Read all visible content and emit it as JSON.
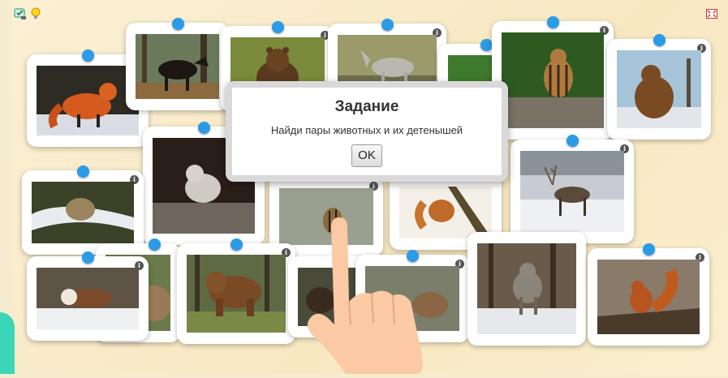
{
  "dialog": {
    "title": "Задание",
    "message": "Найди пары животных и их детенышей",
    "ok_label": "OK"
  },
  "toolbar": {
    "left_icons": [
      "help-check-icon",
      "hint-lightbulb-icon"
    ],
    "right_icons": [
      "fullscreen-icon"
    ]
  },
  "cards": [
    {
      "animal": "fox",
      "info_icon": false
    },
    {
      "animal": "moose",
      "info_icon": false
    },
    {
      "animal": "bear-cub",
      "info_icon": true
    },
    {
      "animal": "moose-calf",
      "info_icon": true
    },
    {
      "animal": "fox-cub",
      "info_icon": true
    },
    {
      "animal": "chipmunk",
      "info_icon": true
    },
    {
      "animal": "beaver",
      "info_icon": true
    },
    {
      "animal": "wolf-cub",
      "info_icon": false
    },
    {
      "animal": "squirrel",
      "info_icon": false
    },
    {
      "animal": "baby-chipmunk",
      "info_icon": true
    },
    {
      "animal": "reindeer",
      "info_icon": true
    },
    {
      "animal": "lynx-kitten",
      "info_icon": true
    },
    {
      "animal": "lynx",
      "info_icon": true
    },
    {
      "animal": "ferret",
      "info_icon": true
    },
    {
      "animal": "brown-bear",
      "info_icon": true
    },
    {
      "animal": "baby-beaver",
      "info_icon": true
    },
    {
      "animal": "beaver-kit",
      "info_icon": true
    },
    {
      "animal": "wolf",
      "info_icon": false
    },
    {
      "animal": "red-squirrel",
      "info_icon": true
    }
  ],
  "pointer": "hand-pointer-icon"
}
